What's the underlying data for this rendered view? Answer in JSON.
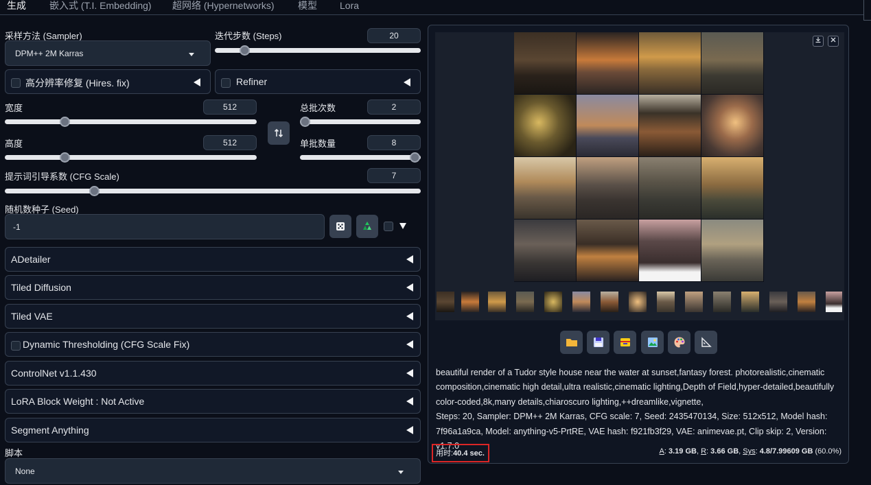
{
  "tabs": [
    "生成",
    "嵌入式 (T.I. Embedding)",
    "超网络 (Hypernetworks)",
    "模型",
    "Lora"
  ],
  "sampler": {
    "label": "采样方法 (Sampler)",
    "value": "DPM++ 2M Karras"
  },
  "steps": {
    "label": "迭代步数 (Steps)",
    "value": "20",
    "fraction": 0.22
  },
  "hires": {
    "label": "高分辨率修复 (Hires. fix)"
  },
  "refiner": {
    "label": "Refiner"
  },
  "width": {
    "label": "宽度",
    "value": "512",
    "fraction": 0.23
  },
  "height": {
    "label": "高度",
    "value": "512",
    "fraction": 0.23
  },
  "batch_count": {
    "label": "总批次数",
    "value": "2",
    "fraction": 0.0
  },
  "batch_size": {
    "label": "单批数量",
    "value": "8",
    "fraction": 1.0
  },
  "swap_icon": "swap-arrows-icon",
  "cfg": {
    "label": "提示词引导系数 (CFG Scale)",
    "value": "7",
    "fraction": 0.21
  },
  "seed": {
    "label": "随机数种子 (Seed)",
    "value": "-1"
  },
  "accordions": [
    "ADetailer",
    "Tiled Diffusion",
    "Tiled VAE",
    "Dynamic Thresholding (CFG Scale Fix)",
    "ControlNet v1.1.430",
    "LoRA Block Weight : Not Active",
    "Segment Anything"
  ],
  "script": {
    "label": "脚本",
    "value": "None"
  },
  "gallery_buttons": [
    "download-icon",
    "close-icon"
  ],
  "tool_icons": [
    "folder-icon",
    "save-icon",
    "zip-icon",
    "image-icon",
    "palette-icon",
    "ruler-icon"
  ],
  "info": {
    "prompt": "beautiful render of a Tudor style house near the water at sunset,fantasy forest. photorealistic,cinematic composition,cinematic high detail,ultra realistic,cinematic lighting,Depth of Field,hyper-detailed,beautifully color-coded,8k,many details,chiaroscuro lighting,++dreamlike,vignette,",
    "params": "Steps: 20, Sampler: DPM++ 2M Karras, CFG scale: 7, Seed: 2435470134, Size: 512x512, Model hash: 7f96a1a9ca, Model: anything-v5-PrtRE, VAE hash: f921fb3f29, VAE: animevae.pt, Clip skip: 2, Version: v1.7.0"
  },
  "time": {
    "label": "用时:",
    "value": "40.4 sec."
  },
  "memory": {
    "a_label": "A",
    "a": "3.19 GB",
    "r_label": "R",
    "r": "3.66 GB",
    "sys_label": "Sys",
    "sys": "4.8/7.99609 GB",
    "pct": "(60.0%)"
  },
  "colors": {
    "background": "#0b0f19",
    "panel": "#111827",
    "border": "#374151",
    "highlight": "#dc2626"
  }
}
